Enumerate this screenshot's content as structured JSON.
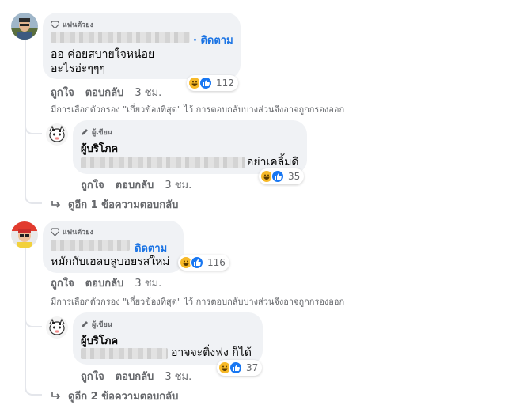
{
  "comments": [
    {
      "badge": "แฟนตัวยง",
      "follow": "· ติดตาม",
      "text_lines": [
        "ออ ค่อยสบายใจหน่อย",
        "อะไรอ่ะๆๆๆ"
      ],
      "actions": {
        "like": "ถูกใจ",
        "reply": "ตอบกลับ",
        "time": "3 ชม."
      },
      "reactions": {
        "icons": [
          "haha-icon",
          "like-icon"
        ],
        "count": "112"
      },
      "filter_note": "มีการเลือกตัวกรอง \"เกี่ยวข้องที่สุด\" ไว้ การตอบกลับบางส่วนจึงอาจถูกกรองออก",
      "reply": {
        "badge": "ผู้เขียน",
        "name": "ผู้บริโภค",
        "text": "อย่าเคลิ้มดิ",
        "actions": {
          "like": "ถูกใจ",
          "reply": "ตอบกลับ",
          "time": "3 ชม."
        },
        "reactions": {
          "icons": [
            "haha-icon",
            "like-icon"
          ],
          "count": "35"
        }
      },
      "more_replies": "ดูอีก 1 ข้อความตอบกลับ"
    },
    {
      "badge": "แฟนตัวยง",
      "follow": "ติดตาม",
      "text_lines": [
        "หมักกับเฮลบลูบอยรสใหม่"
      ],
      "actions": {
        "like": "ถูกใจ",
        "reply": "ตอบกลับ",
        "time": "3 ชม."
      },
      "reactions": {
        "icons": [
          "haha-icon",
          "like-icon"
        ],
        "count": "116"
      },
      "filter_note": "มีการเลือกตัวกรอง \"เกี่ยวข้องที่สุด\" ไว้ การตอบกลับบางส่วนจึงอาจถูกกรองออก",
      "reply": {
        "badge": "ผู้เขียน",
        "name": "ผู้บริโภค",
        "text": "อาจจะติ่งฟง ก็ได้",
        "actions": {
          "like": "ถูกใจ",
          "reply": "ตอบกลับ",
          "time": "3 ชม."
        },
        "reactions": {
          "icons": [
            "haha-icon",
            "like-icon"
          ],
          "count": "37"
        }
      },
      "more_replies": "ดูอีก 2 ข้อความตอบกลับ"
    }
  ],
  "colors": {
    "bubble": "#f0f2f5",
    "link": "#1b74e4",
    "muted": "#65676b",
    "like": "#1877f2",
    "haha": "#f7b928"
  }
}
